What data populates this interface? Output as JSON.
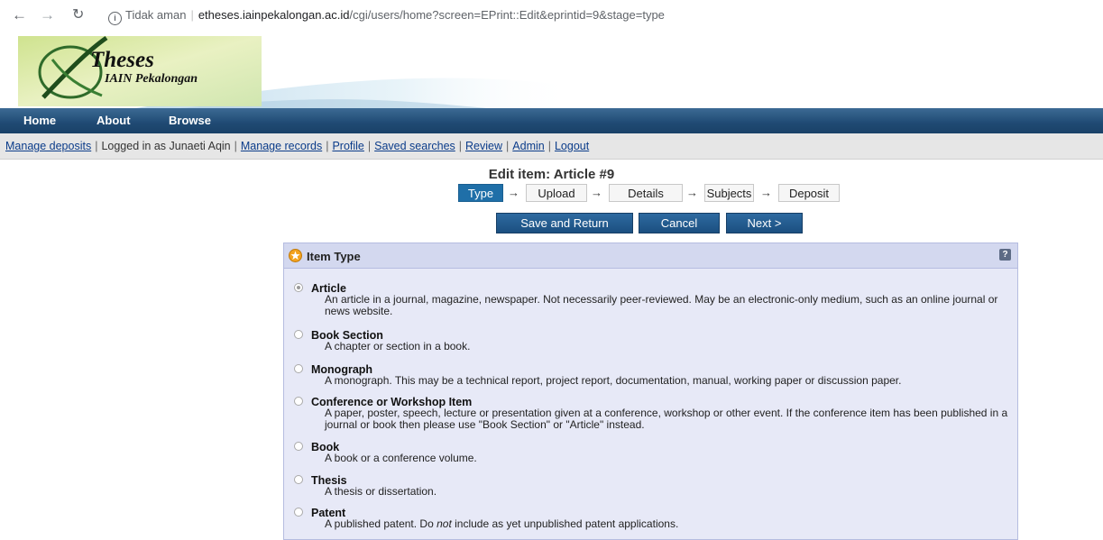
{
  "browser": {
    "security": "Tidak aman",
    "host": "etheses.iainpekalongan.ac.id",
    "path": "/cgi/users/home?screen=EPrint::Edit&eprintid=9&stage=type"
  },
  "logo": {
    "title": "Theses",
    "subtitle": "IAIN Pekalongan"
  },
  "menu": [
    "Home",
    "About",
    "Browse"
  ],
  "tools": {
    "manage_deposits": "Manage deposits",
    "logged_in": "Logged in as Junaeti Aqin",
    "manage_records": "Manage records",
    "profile": "Profile",
    "saved_searches": "Saved searches",
    "review": "Review",
    "admin": "Admin",
    "logout": "Logout",
    "separator": "|"
  },
  "page_title": "Edit item: Article #9",
  "workflow": {
    "stages": [
      "Type",
      "Upload",
      "Details",
      "Subjects",
      "Deposit"
    ],
    "active": "Type",
    "arrow": "→"
  },
  "buttons": {
    "save_return": "Save and Return",
    "cancel": "Cancel",
    "next": "Next >"
  },
  "panel": {
    "title": "Item Type",
    "help": "?",
    "options": [
      {
        "label": "Article",
        "selected": true,
        "desc": "An article in a journal, magazine, newspaper. Not necessarily peer-reviewed. May be an electronic-only medium, such as an online journal or news website."
      },
      {
        "label": "Book Section",
        "selected": false,
        "desc": "A chapter or section in a book."
      },
      {
        "label": "Monograph",
        "selected": false,
        "desc": "A monograph. This may be a technical report, project report, documentation, manual, working paper or discussion paper."
      },
      {
        "label": "Conference or Workshop Item",
        "selected": false,
        "desc": "A paper, poster, speech, lecture or presentation given at a conference, workshop or other event. If the conference item has been published in a journal or book then please use \"Book Section\" or \"Article\" instead."
      },
      {
        "label": "Book",
        "selected": false,
        "desc": "A book or a conference volume."
      },
      {
        "label": "Thesis",
        "selected": false,
        "desc": "A thesis or dissertation."
      },
      {
        "label": "Patent",
        "selected": false,
        "desc_before": "A published patent. Do ",
        "desc_em": "not",
        "desc_after": " include as yet unpublished patent applications."
      }
    ]
  },
  "colors": {
    "menu_bar": "#1f4a73",
    "active_stage": "#1f6fa8",
    "panel_bg": "#e7e9f7",
    "link": "#0b3c8a"
  }
}
